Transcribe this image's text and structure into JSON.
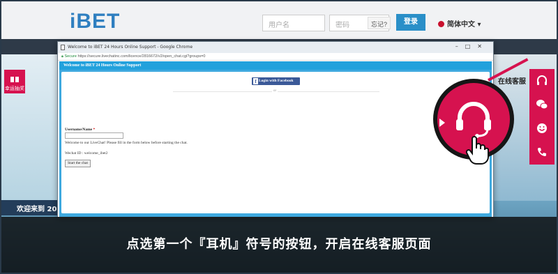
{
  "site": {
    "logo": "iBET",
    "username_placeholder": "用户名",
    "password_placeholder": "密码",
    "forgot_label": "忘记?",
    "login_label": "登录",
    "language_label": "简体中文",
    "gift_label": "幸运抽奖",
    "welcome_label": "欢迎来到 20"
  },
  "sidebar": {
    "service_label": "在线客服",
    "icons": [
      "headset-icon",
      "wechat-icon",
      "smile-icon",
      "phone-icon"
    ]
  },
  "popup": {
    "window_title": "Welcome to iBET 24 Hours Online Support - Google Chrome",
    "secure_label": "Secure",
    "url": "https://secure.livechatinc.com/licence/2816672/v2/open_chat.cgi?groups=0",
    "chat_header": "Welcome to iBET 24 Hours Online Support",
    "facebook_label": "Login with Facebook",
    "or_label": "or",
    "name_label": "Username/Name",
    "required_mark": "*",
    "welcome_text": "Welcome to our LiveChat! Please fill in the form below before starting the chat.",
    "wechat_text": "Wechat ID : welcome_ibet2",
    "start_label": "Start the chat"
  },
  "caption": "点选第一个『耳机』符号的按钮，开启在线客服页面",
  "colors": {
    "accent": "#d6124f",
    "chat_blue": "#22a1dc",
    "facebook": "#3b5998"
  }
}
